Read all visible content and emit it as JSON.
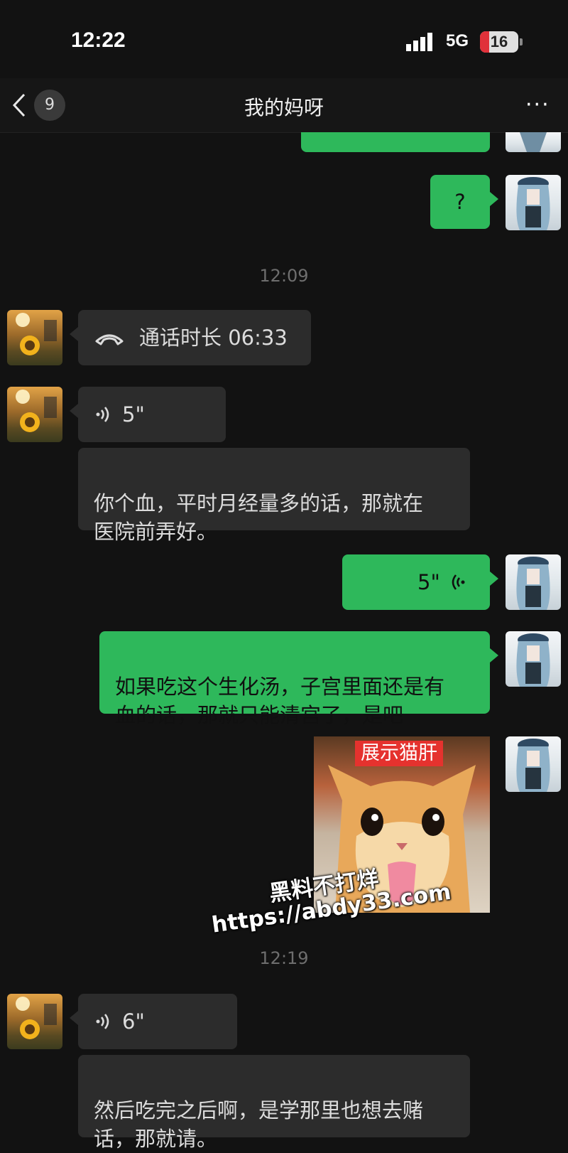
{
  "status_bar": {
    "time": "12:22",
    "network": "5G",
    "battery": "16",
    "battery_level": 0.16
  },
  "header": {
    "back_count": "9",
    "title": "我的妈呀",
    "more": "···"
  },
  "messages": {
    "m_partial": "",
    "m_question": "?",
    "ts1": "12:09",
    "call": "通话时长 06:33",
    "voice1": "5\"",
    "text1": "你个血，平时月经量多的话，那就在\n医院前弄好。",
    "voice_out": "5\"",
    "text2": "如果吃这个生化汤，子宫里面还是有\n血的话，那就只能清宫了，是吧",
    "sticker_label": "展示猫肝",
    "ts2": "12:19",
    "voice2": "6\"",
    "text3": "然后吃完之后啊，是学那里也想去赌\n话，那就请。"
  },
  "watermark": {
    "line1": "黑料不打烊",
    "line2": "https://abdy33.com"
  },
  "colors": {
    "background": "#121212",
    "outgoing": "#2eb85b",
    "incoming": "#2c2c2c"
  }
}
